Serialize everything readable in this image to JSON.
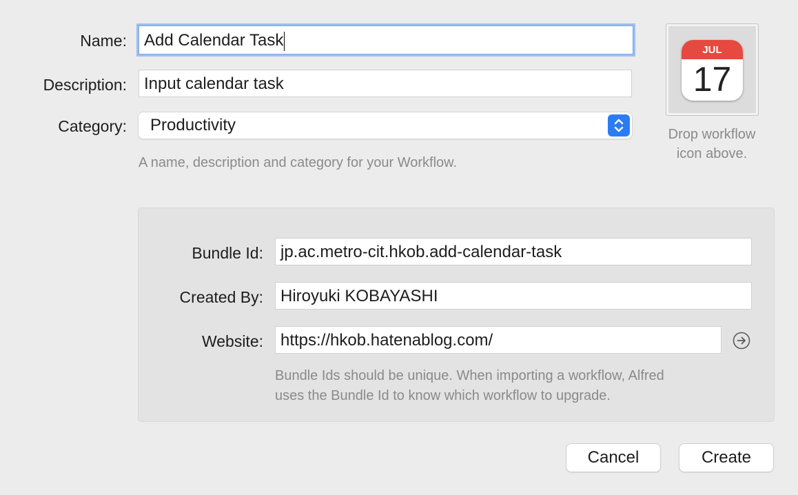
{
  "form": {
    "name_label": "Name:",
    "name_value": "Add Calendar Task",
    "description_label": "Description:",
    "description_value": "Input calendar task",
    "category_label": "Category:",
    "category_value": "Productivity",
    "helper_text": "A name, description and category for your Workflow."
  },
  "icon_well": {
    "month": "JUL",
    "day": "17",
    "drop_text_line1": "Drop workflow",
    "drop_text_line2": "icon above."
  },
  "bundle": {
    "bundle_id_label": "Bundle Id:",
    "bundle_id_value": "jp.ac.metro-cit.hkob.add-calendar-task",
    "created_by_label": "Created By:",
    "created_by_value": "Hiroyuki KOBAYASHI",
    "website_label": "Website:",
    "website_value": "https://hkob.hatenablog.com/",
    "helper_line1": "Bundle Ids should be unique. When importing a workflow, Alfred",
    "helper_line2": "uses the Bundle Id to know which workflow to upgrade."
  },
  "buttons": {
    "cancel": "Cancel",
    "create": "Create"
  },
  "colors": {
    "accent": "#2b7cf3",
    "focus_ring": "#9dbff0",
    "calendar_red": "#e6493f"
  }
}
